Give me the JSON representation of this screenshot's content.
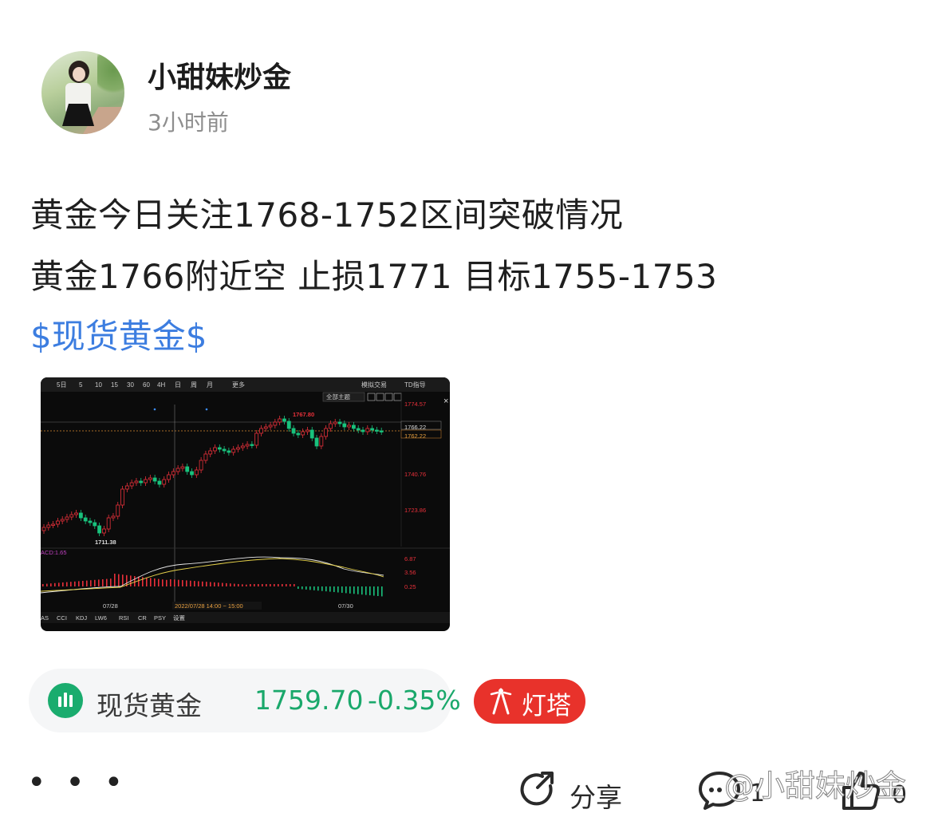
{
  "post": {
    "author": "小甜妹炒金",
    "time": "3小时前",
    "line1": "黄金今日关注1768-1752区间突破情况",
    "line2": "黄金1766附近空 止损1771 目标1755-1753",
    "tag": "$现货黄金$"
  },
  "chart_image": {
    "toolbar": [
      "5日",
      "5",
      "10",
      "15",
      "30",
      "60",
      "4H",
      "日",
      "周",
      "月",
      "更多",
      "模拟交易",
      "TD指导"
    ],
    "theme_button": "全部主题",
    "price_labels": [
      "1774.57",
      "1766.22",
      "1762.22",
      "1740.76",
      "1723.86"
    ],
    "high_label": "1767.80",
    "low_label": "1711.38",
    "macd_label": "ACD:1.65",
    "macd_axis": [
      "6.87",
      "3.56",
      "0.25"
    ],
    "date_labels": [
      "07/28",
      "07/30"
    ],
    "crosshair_label": "2022/07/28 14:00 ~ 15:00",
    "bottom_tabs": [
      "AS",
      "CCI",
      "KDJ",
      "LW6",
      "RSI",
      "CR",
      "PSY",
      "设置"
    ],
    "colors": {
      "up": "#e8303a",
      "down": "#19c27d",
      "bg": "#0b0b0b"
    }
  },
  "quote": {
    "icon": "bar-chart-icon",
    "name": "现货黄金",
    "price": "1759.70",
    "change": "-0.35%",
    "color": "#1aa86b"
  },
  "dengta": {
    "label": "灯塔",
    "color": "#e8322b"
  },
  "actions": {
    "more": "• • •",
    "share": "分享",
    "comment_count": "1",
    "like_count": "0"
  },
  "watermark": "@小甜妹炒金"
}
